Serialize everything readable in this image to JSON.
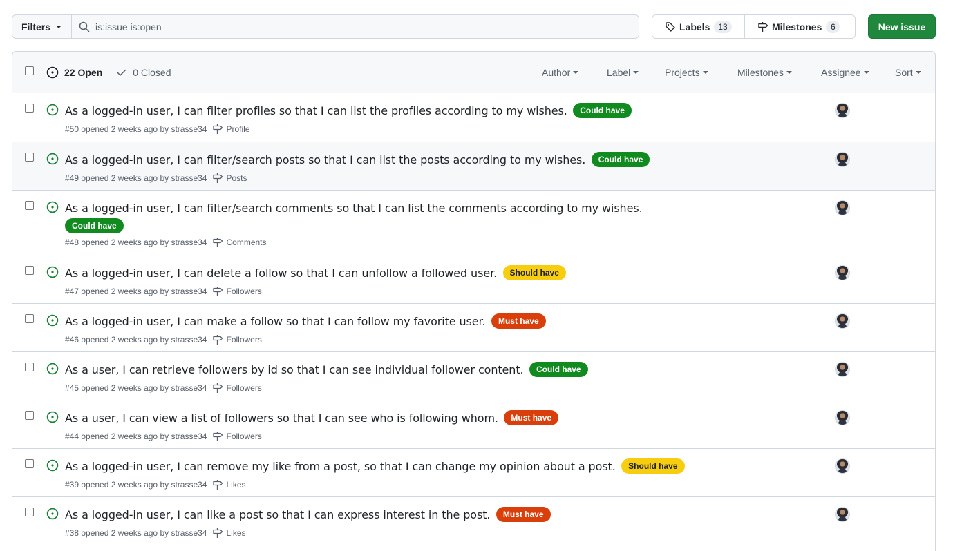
{
  "toolbar": {
    "filters_label": "Filters",
    "search_value": "is:issue is:open",
    "labels_label": "Labels",
    "labels_count": "13",
    "milestones_label": "Milestones",
    "milestones_count": "6",
    "new_issue_label": "New issue"
  },
  "list_header": {
    "open_label": "22 Open",
    "closed_label": "0 Closed",
    "filters": [
      "Author",
      "Label",
      "Projects",
      "Milestones",
      "Assignee",
      "Sort"
    ]
  },
  "colors": {
    "could_have": "#118a20",
    "should_have": "#f7cd10",
    "must_have": "#d93f0b",
    "open_icon": "#1a7f37",
    "new_issue_button": "#1f883d"
  },
  "issues": [
    {
      "title": "As a logged-in user, I can filter profiles so that I can list the profiles according to my wishes.",
      "label": "Could have",
      "label_kind": "could",
      "meta": "#50 opened 2 weeks ago by strasse34",
      "milestone": "Profile"
    },
    {
      "title": "As a logged-in user, I can filter/search posts so that I can list the posts according to my wishes.",
      "label": "Could have",
      "label_kind": "could",
      "meta": "#49 opened 2 weeks ago by strasse34",
      "milestone": "Posts"
    },
    {
      "title": "As a logged-in user, I can filter/search comments so that I can list the comments according to my wishes.",
      "label": "Could have",
      "label_kind": "could",
      "meta": "#48 opened 2 weeks ago by strasse34",
      "milestone": "Comments"
    },
    {
      "title": "As a logged-in user, I can delete a follow so that I can unfollow a followed user.",
      "label": "Should have",
      "label_kind": "should",
      "meta": "#47 opened 2 weeks ago by strasse34",
      "milestone": "Followers"
    },
    {
      "title": "As a logged-in user, I can make a follow so that I can follow my favorite user.",
      "label": "Must have",
      "label_kind": "must",
      "meta": "#46 opened 2 weeks ago by strasse34",
      "milestone": "Followers"
    },
    {
      "title": "As a user, I can retrieve followers by id so that I can see individual follower content.",
      "label": "Could have",
      "label_kind": "could",
      "meta": "#45 opened 2 weeks ago by strasse34",
      "milestone": "Followers"
    },
    {
      "title": "As a user, I can view a list of followers so that I can see who is following whom.",
      "label": "Must have",
      "label_kind": "must",
      "meta": "#44 opened 2 weeks ago by strasse34",
      "milestone": "Followers"
    },
    {
      "title": "As a logged-in user, I can remove my like from a post, so that I can change my opinion about a post.",
      "label": "Should have",
      "label_kind": "should",
      "meta": "#39 opened 2 weeks ago by strasse34",
      "milestone": "Likes"
    },
    {
      "title": "As a logged-in user, I can like a post so that I can express interest in the post.",
      "label": "Must have",
      "label_kind": "must",
      "meta": "#38 opened 2 weeks ago by strasse34",
      "milestone": "Likes"
    }
  ]
}
